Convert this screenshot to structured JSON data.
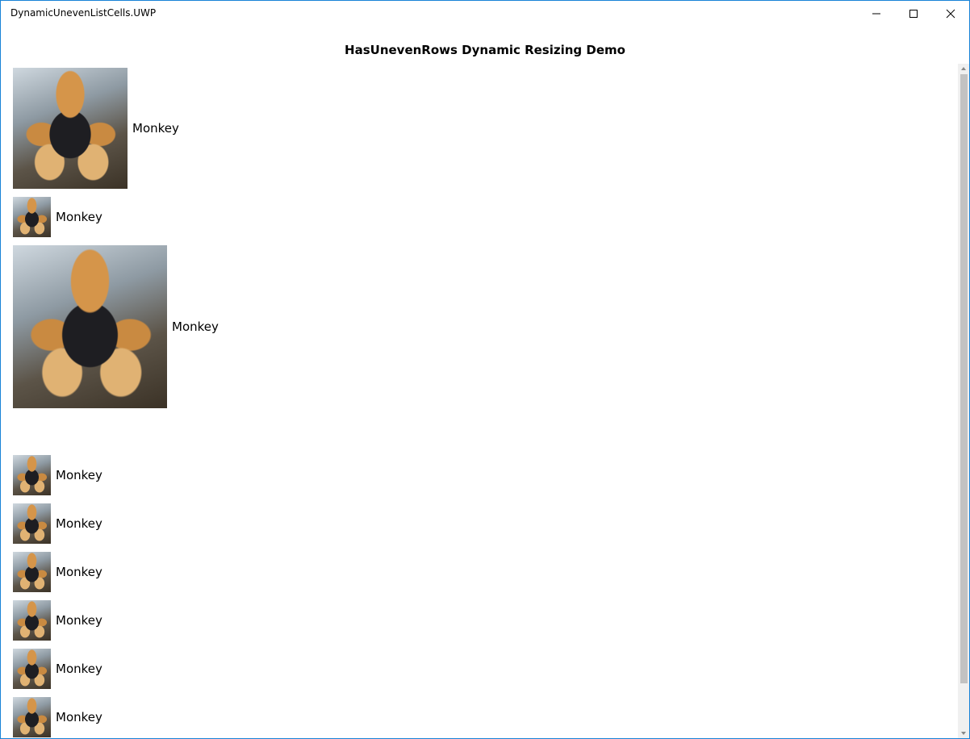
{
  "window": {
    "title": "DynamicUnevenListCells.UWP",
    "minimize_icon": "minimize-icon",
    "maximize_icon": "maximize-icon",
    "close_icon": "close-icon"
  },
  "page": {
    "header": "HasUnevenRows Dynamic Resizing Demo"
  },
  "list": {
    "items": [
      {
        "label": "Monkey",
        "image": "monkey-photo"
      },
      {
        "label": "Monkey",
        "image": "monkey-photo"
      },
      {
        "label": "Monkey",
        "image": "monkey-photo"
      },
      {
        "label": "Monkey",
        "image": "monkey-photo"
      },
      {
        "label": "Monkey",
        "image": "monkey-photo"
      },
      {
        "label": "Monkey",
        "image": "monkey-photo"
      },
      {
        "label": "Monkey",
        "image": "monkey-photo"
      },
      {
        "label": "Monkey",
        "image": "monkey-photo"
      },
      {
        "label": "Monkey",
        "image": "monkey-photo"
      }
    ]
  },
  "colors": {
    "window_border": "#1883d7",
    "background": "#ffffff",
    "text": "#000000",
    "scrollbar_track": "#f0f0f0",
    "scrollbar_thumb": "#c2c2c2"
  }
}
